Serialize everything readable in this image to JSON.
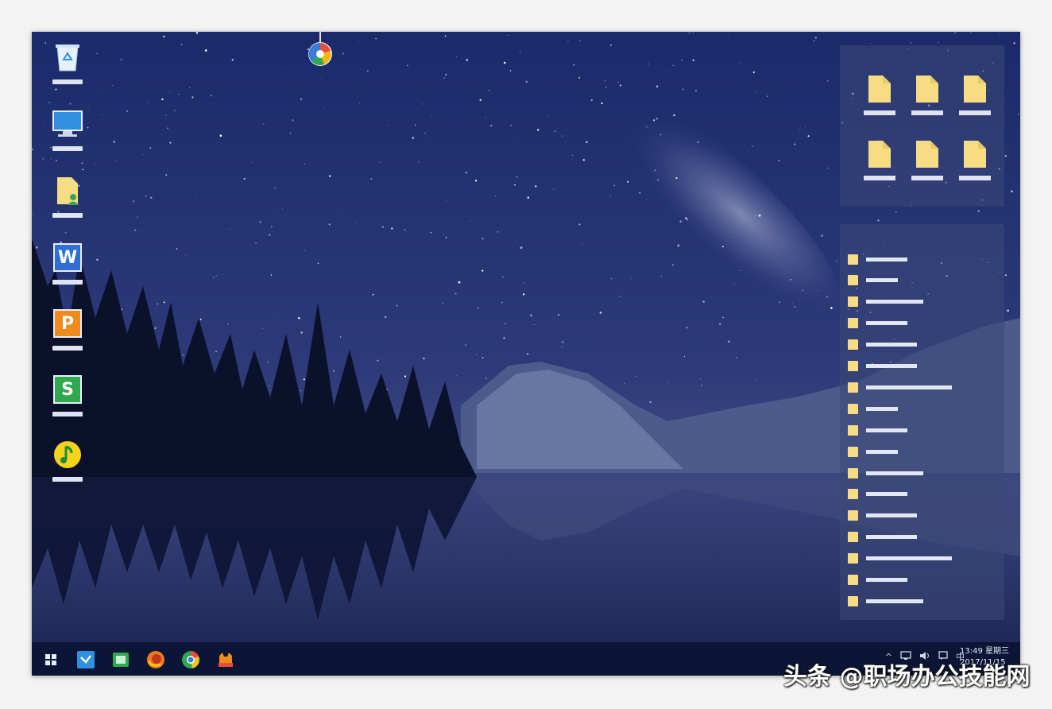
{
  "desktop": {
    "icons": [
      {
        "name": "recycle-bin-icon",
        "label": ""
      },
      {
        "name": "computer-icon",
        "label": ""
      },
      {
        "name": "user-folder-icon",
        "label": ""
      },
      {
        "name": "wps-writer-icon",
        "label": "W"
      },
      {
        "name": "wps-presentation-icon",
        "label": "P"
      },
      {
        "name": "wps-spreadsheet-icon",
        "label": "S"
      },
      {
        "name": "music-player-icon",
        "label": ""
      }
    ],
    "pin_icon": "pushpin-balloon-icon"
  },
  "fences": {
    "grid_items": [
      "",
      "",
      "",
      "",
      "",
      ""
    ],
    "list_items": [
      "",
      "",
      "",
      "",
      "",
      "",
      "",
      "",
      "",
      "",
      "",
      "",
      "",
      "",
      "",
      "",
      ""
    ]
  },
  "taskbar": {
    "start_icon": "windows-start-icon",
    "apps": [
      "arrow-app-icon",
      "recycle-app-icon",
      "firefox-icon",
      "chrome-icon",
      "cat-app-icon"
    ],
    "tray": {
      "chevron": "^",
      "ime": "中"
    },
    "clock": {
      "time": "13:49 星期三",
      "date": "2017/11/15"
    }
  },
  "watermark": "头条 @职场办公技能网",
  "colors": {
    "folder": "#f6dd83",
    "fence_bg": "#3a4878",
    "taskbar_bg": "#0b1535"
  }
}
